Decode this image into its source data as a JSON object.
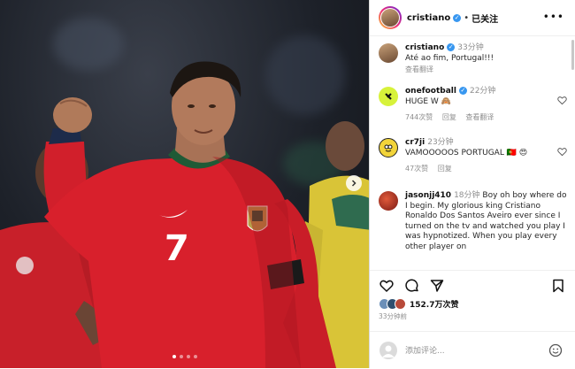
{
  "post": {
    "images_count": 4,
    "active_index": 1
  },
  "header": {
    "username": "cristiano",
    "verified_glyph": "✓",
    "separator": "•",
    "follow_status": "已关注",
    "more_glyph": "•••"
  },
  "comments": [
    {
      "username": "cristiano",
      "time": "33分钟",
      "text": "Até ao fim, Portugal!!!",
      "translate": "查看翻译",
      "verified": true,
      "avatar_color": "#a07a5a"
    },
    {
      "username": "onefootball",
      "time": "22分钟",
      "text": "HUGE W 🙈",
      "likes": "744次赞",
      "reply": "回复",
      "translate": "查看翻译",
      "verified": true,
      "avatar_color": "#d7f23a"
    },
    {
      "username": "cr7ji",
      "time": "23分钟",
      "text": "VAMOOOOOS PORTUGAL 🇵🇹 😍",
      "likes": "47次赞",
      "reply": "回复",
      "verified": false,
      "avatar_color": "#f2d43a"
    },
    {
      "username": "jasonjj410",
      "time": "18分钟",
      "text": "Boy oh boy where do I begin. My glorious king Cristiano Ronaldo Dos Santos Aveiro ever since I turned on the tv and watched you play I was hypnotized. When you play every other player on",
      "verified": false,
      "avatar_color": "#b23a2a"
    }
  ],
  "actions": {
    "like_icon": "heart-icon",
    "comment_icon": "comment-icon",
    "share_icon": "share-icon",
    "save_icon": "bookmark-icon"
  },
  "likes_text": "152.7万次赞",
  "post_time": "33分钟前",
  "comment_input": {
    "placeholder": "添加评论..."
  },
  "jersey": {
    "number": "7"
  }
}
